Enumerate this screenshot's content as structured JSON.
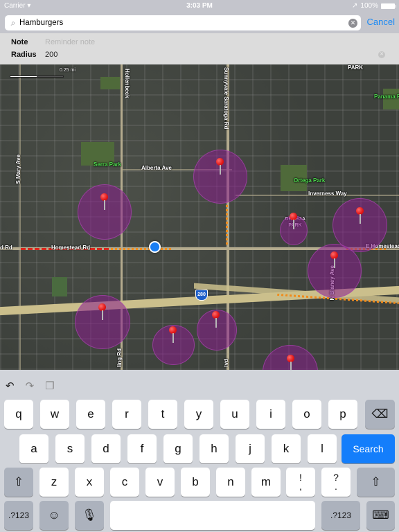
{
  "status_bar": {
    "carrier": "Carrier",
    "time": "3:03 PM",
    "battery": "100%"
  },
  "search": {
    "value": "Hamburgers",
    "cancel_label": "Cancel"
  },
  "form": {
    "note_label": "Note",
    "note_placeholder": "Reminder note",
    "radius_label": "Radius",
    "radius_value": "200"
  },
  "map": {
    "scale_label": "0.25 mi",
    "labels": {
      "hollenbeck": "Hollenbeck",
      "sunnyvale_saratoga": "Sunnyvale Saratoga Rd",
      "alberta": "Alberta Ave",
      "serra_park": "Serra Park",
      "s_mary": "S Mary Ave",
      "ortega_park": "Ortega Park",
      "inverness": "Inverness Way",
      "park_top": "PARK",
      "panama_park": "Panama Park",
      "homestead": "Homestead Rd",
      "homestead_left": "d Rd",
      "e_homestead": "E Homestead",
      "ortega_pin_label": "ORTEGA PARK",
      "n_blaney": "N Blaney Ave",
      "interstate": "280",
      "ling_rd": "ling Rd",
      "blvd": "lvd"
    },
    "geofence_count": 9
  },
  "keyboard": {
    "row1": [
      "q",
      "w",
      "e",
      "r",
      "t",
      "y",
      "u",
      "i",
      "o",
      "p"
    ],
    "row2": [
      "a",
      "s",
      "d",
      "f",
      "g",
      "h",
      "j",
      "k",
      "l"
    ],
    "row3": [
      "z",
      "x",
      "c",
      "v",
      "b",
      "n",
      "m"
    ],
    "punct1": [
      "!",
      ","
    ],
    "punct2": [
      "?",
      "."
    ],
    "search_label": "Search",
    "numbers_label": ".?123"
  }
}
